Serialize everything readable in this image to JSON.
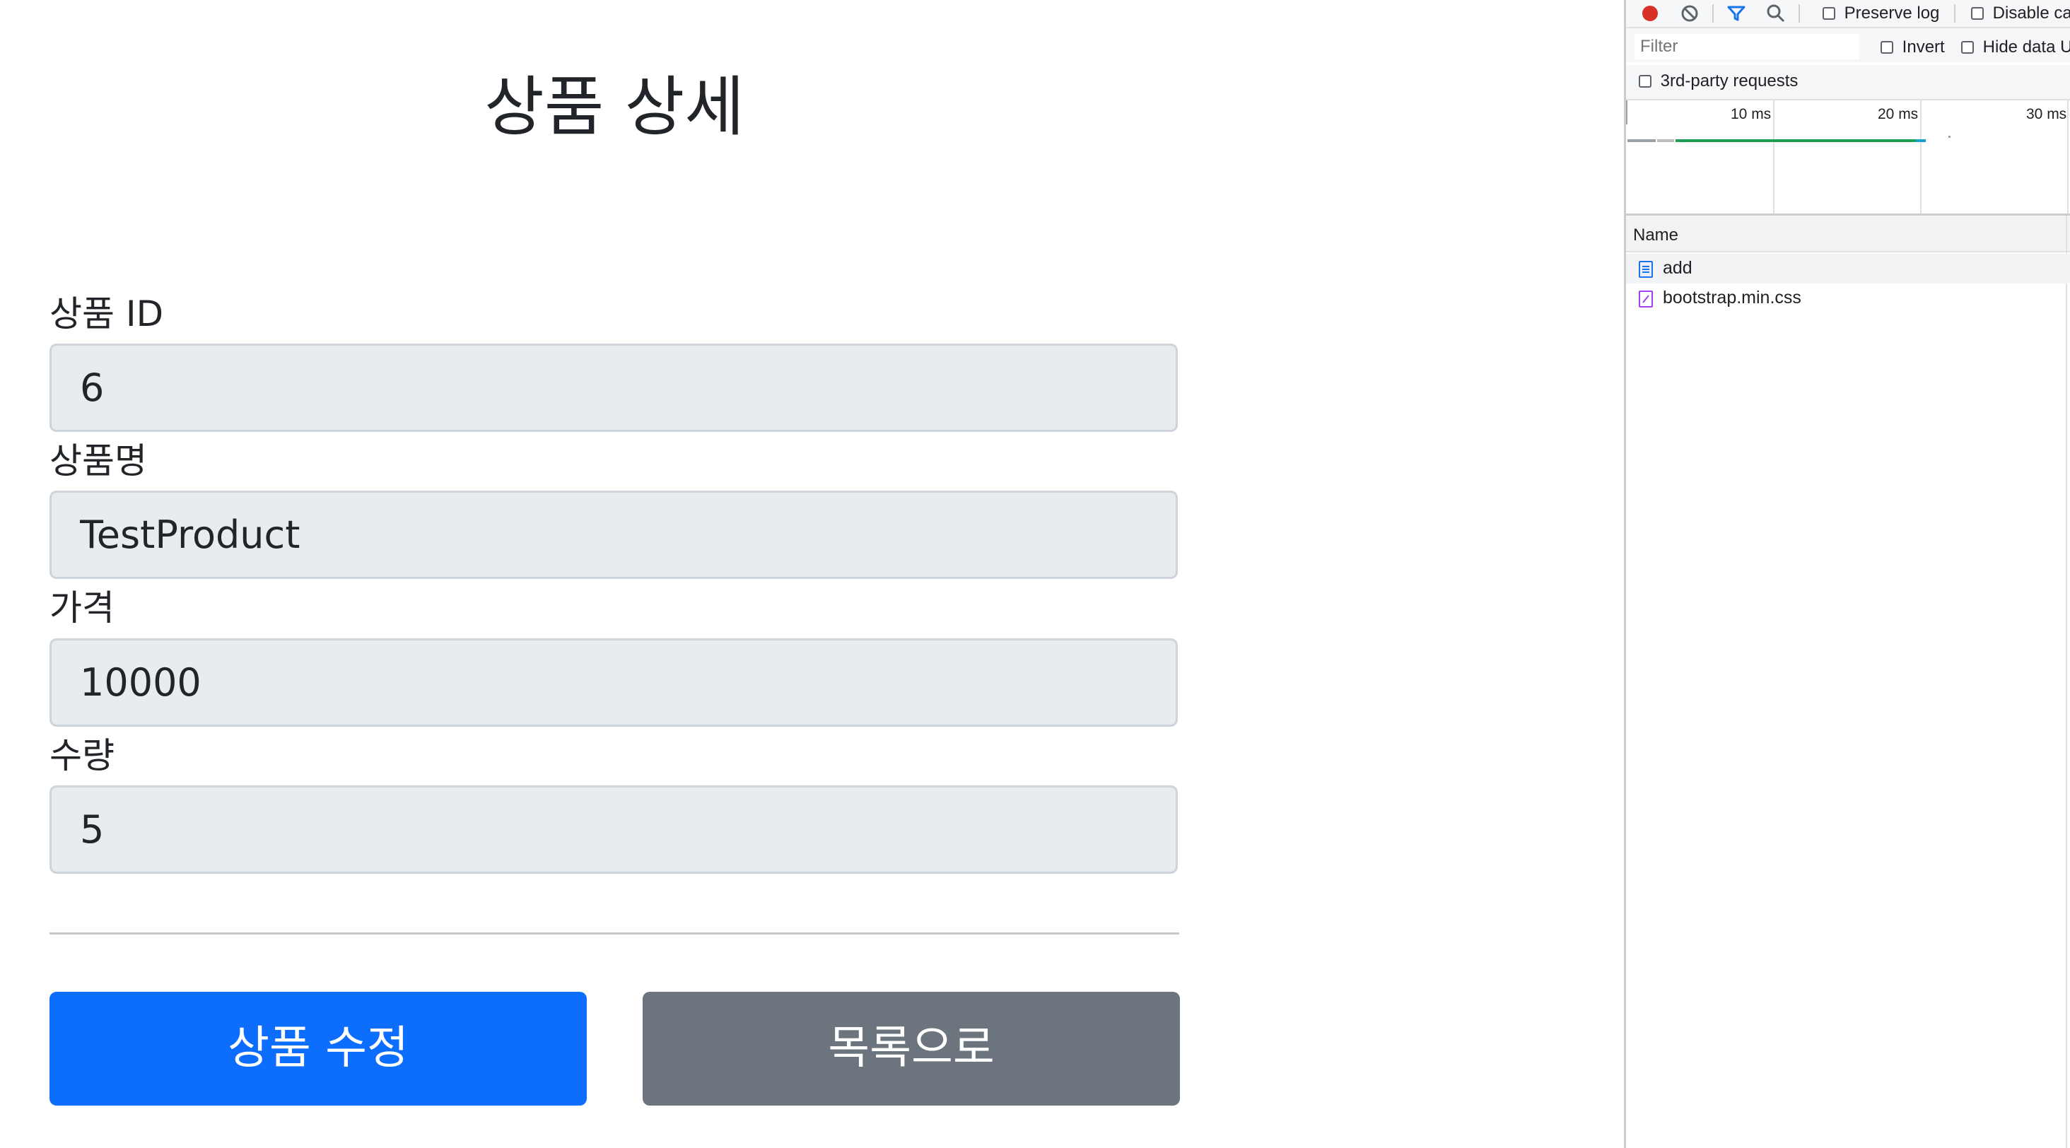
{
  "page": {
    "title": "상품 상세",
    "fields": [
      {
        "label": "상품 ID",
        "value": "6"
      },
      {
        "label": "상품명",
        "value": "TestProduct"
      },
      {
        "label": "가격",
        "value": "10000"
      },
      {
        "label": "수량",
        "value": "5"
      }
    ],
    "buttons": {
      "edit_label": "상품 수정",
      "list_label": "목록으로"
    },
    "colors": {
      "primary": "#0d6efd",
      "secondary": "#6c757d",
      "input_bg": "#e9ecef"
    }
  },
  "devtools": {
    "toolbar": {
      "record_icon": "record-icon",
      "clear_icon": "clear-icon",
      "filter_icon": "filter-icon",
      "search_icon": "search-icon",
      "preserve_log_label": "Preserve log",
      "disable_cache_label": "Disable ca"
    },
    "filter": {
      "placeholder": "Filter",
      "invert_label": "Invert",
      "hide_data_label": "Hide data U",
      "third_party_label": "3rd-party requests"
    },
    "timeline": {
      "ticks": [
        "10 ms",
        "20 ms",
        "30 ms"
      ]
    },
    "table": {
      "name_header": "Name",
      "requests": [
        {
          "name": "add",
          "icon": "document-icon"
        },
        {
          "name": "bootstrap.min.css",
          "icon": "stylesheet-icon"
        }
      ]
    }
  }
}
